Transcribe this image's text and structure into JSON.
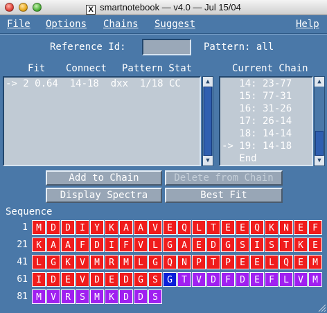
{
  "window": {
    "title": "smartnotebook — v4.0 — Jul 15/04",
    "x_icon": "X"
  },
  "menu": {
    "file": "File",
    "options": "Options",
    "chains": "Chains",
    "suggest": "Suggest",
    "help": "Help"
  },
  "reference": {
    "label": "Reference Id:",
    "value": "",
    "pattern_label": "Pattern: all"
  },
  "fit_list": {
    "headers": {
      "fit": "Fit",
      "connect": "Connect",
      "pattern_stat": "Pattern Stat"
    },
    "rows": [
      "-> 2 0.64  14-18  dxx  1/18 CC"
    ]
  },
  "chain_list": {
    "header": "Current Chain",
    "rows": [
      "   14: 23-77",
      "   15: 77-31",
      "   16: 31-26",
      "   17: 26-14",
      "   18: 14-14",
      "-> 19: 14-18",
      "   End"
    ]
  },
  "buttons": {
    "add_to_chain": "Add to Chain",
    "delete_from_chain": "Delete from Chain",
    "display_spectra": "Display Spectra",
    "best_fit": "Best Fit"
  },
  "sequence": {
    "label": "Sequence",
    "rows": [
      {
        "start": "1",
        "residues": [
          "M",
          "D",
          "D",
          "I",
          "Y",
          "K",
          "A",
          "A",
          "V",
          "E",
          "Q",
          "L",
          "T",
          "E",
          "E",
          "Q",
          "K",
          "N",
          "E",
          "F"
        ]
      },
      {
        "start": "21",
        "residues": [
          "K",
          "A",
          "A",
          "F",
          "D",
          "I",
          "F",
          "V",
          "L",
          "G",
          "A",
          "E",
          "D",
          "G",
          "S",
          "I",
          "S",
          "T",
          "K",
          "E"
        ]
      },
      {
        "start": "41",
        "residues": [
          "L",
          "G",
          "K",
          "V",
          "M",
          "R",
          "M",
          "L",
          "G",
          "Q",
          "N",
          "P",
          "T",
          "P",
          "E",
          "E",
          "L",
          "Q",
          "E",
          "M"
        ]
      },
      {
        "start": "61",
        "residues": [
          "I",
          "D",
          "E",
          "V",
          "D",
          "E",
          "D",
          "G",
          "S",
          "G",
          "T",
          "V",
          "D",
          "F",
          "D",
          "E",
          "F",
          "L",
          "V",
          "M"
        ]
      },
      {
        "start": "81",
        "residues": [
          "M",
          "V",
          "R",
          "S",
          "M",
          "K",
          "D",
          "D",
          "S"
        ]
      }
    ],
    "colors": {
      "red": "#f01c1c",
      "blue": "#0a1fd8",
      "purple": "#a020f0"
    },
    "color_map": [
      "rrrrrrrrrrrrrrrrrrrr",
      "rrrrrrrrrrrrrrrrrrrr",
      "rrrrrrrrrrrrrrrrrrrr",
      "rrrrrrrrrbpppppppppp",
      "ppppppppp"
    ]
  }
}
